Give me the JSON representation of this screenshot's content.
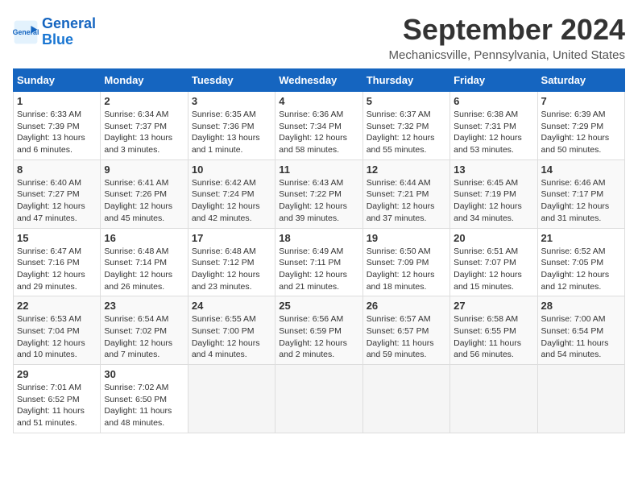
{
  "header": {
    "logo_line1": "General",
    "logo_line2": "Blue",
    "month": "September 2024",
    "location": "Mechanicsville, Pennsylvania, United States"
  },
  "weekdays": [
    "Sunday",
    "Monday",
    "Tuesday",
    "Wednesday",
    "Thursday",
    "Friday",
    "Saturday"
  ],
  "weeks": [
    [
      {
        "day": "1",
        "info": "Sunrise: 6:33 AM\nSunset: 7:39 PM\nDaylight: 13 hours\nand 6 minutes."
      },
      {
        "day": "2",
        "info": "Sunrise: 6:34 AM\nSunset: 7:37 PM\nDaylight: 13 hours\nand 3 minutes."
      },
      {
        "day": "3",
        "info": "Sunrise: 6:35 AM\nSunset: 7:36 PM\nDaylight: 13 hours\nand 1 minute."
      },
      {
        "day": "4",
        "info": "Sunrise: 6:36 AM\nSunset: 7:34 PM\nDaylight: 12 hours\nand 58 minutes."
      },
      {
        "day": "5",
        "info": "Sunrise: 6:37 AM\nSunset: 7:32 PM\nDaylight: 12 hours\nand 55 minutes."
      },
      {
        "day": "6",
        "info": "Sunrise: 6:38 AM\nSunset: 7:31 PM\nDaylight: 12 hours\nand 53 minutes."
      },
      {
        "day": "7",
        "info": "Sunrise: 6:39 AM\nSunset: 7:29 PM\nDaylight: 12 hours\nand 50 minutes."
      }
    ],
    [
      {
        "day": "8",
        "info": "Sunrise: 6:40 AM\nSunset: 7:27 PM\nDaylight: 12 hours\nand 47 minutes."
      },
      {
        "day": "9",
        "info": "Sunrise: 6:41 AM\nSunset: 7:26 PM\nDaylight: 12 hours\nand 45 minutes."
      },
      {
        "day": "10",
        "info": "Sunrise: 6:42 AM\nSunset: 7:24 PM\nDaylight: 12 hours\nand 42 minutes."
      },
      {
        "day": "11",
        "info": "Sunrise: 6:43 AM\nSunset: 7:22 PM\nDaylight: 12 hours\nand 39 minutes."
      },
      {
        "day": "12",
        "info": "Sunrise: 6:44 AM\nSunset: 7:21 PM\nDaylight: 12 hours\nand 37 minutes."
      },
      {
        "day": "13",
        "info": "Sunrise: 6:45 AM\nSunset: 7:19 PM\nDaylight: 12 hours\nand 34 minutes."
      },
      {
        "day": "14",
        "info": "Sunrise: 6:46 AM\nSunset: 7:17 PM\nDaylight: 12 hours\nand 31 minutes."
      }
    ],
    [
      {
        "day": "15",
        "info": "Sunrise: 6:47 AM\nSunset: 7:16 PM\nDaylight: 12 hours\nand 29 minutes."
      },
      {
        "day": "16",
        "info": "Sunrise: 6:48 AM\nSunset: 7:14 PM\nDaylight: 12 hours\nand 26 minutes."
      },
      {
        "day": "17",
        "info": "Sunrise: 6:48 AM\nSunset: 7:12 PM\nDaylight: 12 hours\nand 23 minutes."
      },
      {
        "day": "18",
        "info": "Sunrise: 6:49 AM\nSunset: 7:11 PM\nDaylight: 12 hours\nand 21 minutes."
      },
      {
        "day": "19",
        "info": "Sunrise: 6:50 AM\nSunset: 7:09 PM\nDaylight: 12 hours\nand 18 minutes."
      },
      {
        "day": "20",
        "info": "Sunrise: 6:51 AM\nSunset: 7:07 PM\nDaylight: 12 hours\nand 15 minutes."
      },
      {
        "day": "21",
        "info": "Sunrise: 6:52 AM\nSunset: 7:05 PM\nDaylight: 12 hours\nand 12 minutes."
      }
    ],
    [
      {
        "day": "22",
        "info": "Sunrise: 6:53 AM\nSunset: 7:04 PM\nDaylight: 12 hours\nand 10 minutes."
      },
      {
        "day": "23",
        "info": "Sunrise: 6:54 AM\nSunset: 7:02 PM\nDaylight: 12 hours\nand 7 minutes."
      },
      {
        "day": "24",
        "info": "Sunrise: 6:55 AM\nSunset: 7:00 PM\nDaylight: 12 hours\nand 4 minutes."
      },
      {
        "day": "25",
        "info": "Sunrise: 6:56 AM\nSunset: 6:59 PM\nDaylight: 12 hours\nand 2 minutes."
      },
      {
        "day": "26",
        "info": "Sunrise: 6:57 AM\nSunset: 6:57 PM\nDaylight: 11 hours\nand 59 minutes."
      },
      {
        "day": "27",
        "info": "Sunrise: 6:58 AM\nSunset: 6:55 PM\nDaylight: 11 hours\nand 56 minutes."
      },
      {
        "day": "28",
        "info": "Sunrise: 7:00 AM\nSunset: 6:54 PM\nDaylight: 11 hours\nand 54 minutes."
      }
    ],
    [
      {
        "day": "29",
        "info": "Sunrise: 7:01 AM\nSunset: 6:52 PM\nDaylight: 11 hours\nand 51 minutes."
      },
      {
        "day": "30",
        "info": "Sunrise: 7:02 AM\nSunset: 6:50 PM\nDaylight: 11 hours\nand 48 minutes."
      },
      {
        "day": "",
        "info": ""
      },
      {
        "day": "",
        "info": ""
      },
      {
        "day": "",
        "info": ""
      },
      {
        "day": "",
        "info": ""
      },
      {
        "day": "",
        "info": ""
      }
    ]
  ]
}
